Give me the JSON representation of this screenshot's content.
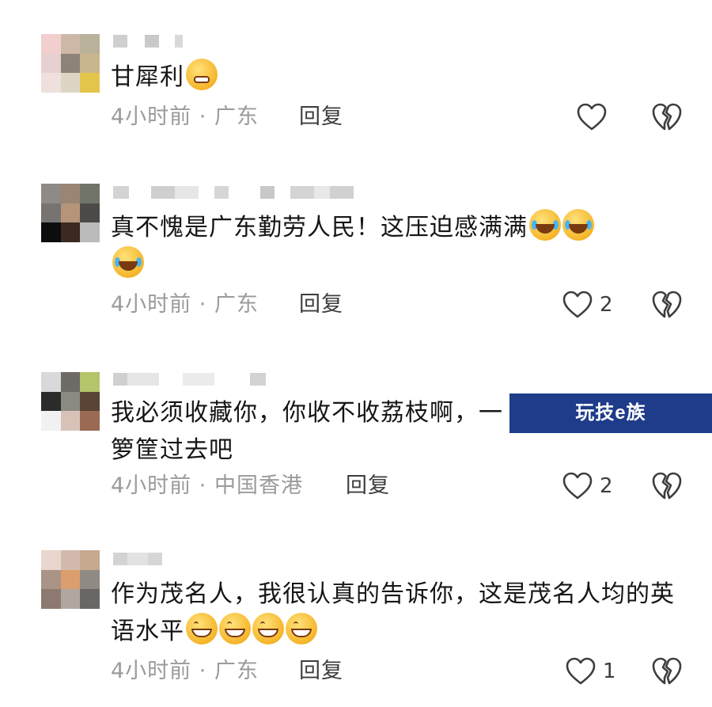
{
  "comments": [
    {
      "text": "甘犀利",
      "time": "4小时前",
      "location": "广东",
      "reply_label": "回复",
      "like_count": ""
    },
    {
      "text": "真不愧是广东勤劳人民！这压迫感满满",
      "time": "4小时前",
      "location": "广东",
      "reply_label": "回复",
      "like_count": "2"
    },
    {
      "text": "我必须收藏你，你收不收荔枝啊，一箩筐过去吧",
      "time": "4小时前",
      "location": "中国香港",
      "reply_label": "回复",
      "like_count": "2"
    },
    {
      "text": "作为茂名人，我很认真的告诉你，这是茂名人均的英语水平",
      "time": "4小时前",
      "location": "广东",
      "reply_label": "回复",
      "like_count": "1"
    }
  ],
  "meta_separator": "·",
  "watermark": {
    "text": "玩技e族"
  },
  "icons": {
    "like": "heart-outline-icon",
    "dislike": "broken-heart-icon"
  },
  "colors": {
    "text": "#161616",
    "meta": "#9b9b9b",
    "reply": "#3d3d3d",
    "watermark_bg": "#1e3c8a"
  }
}
